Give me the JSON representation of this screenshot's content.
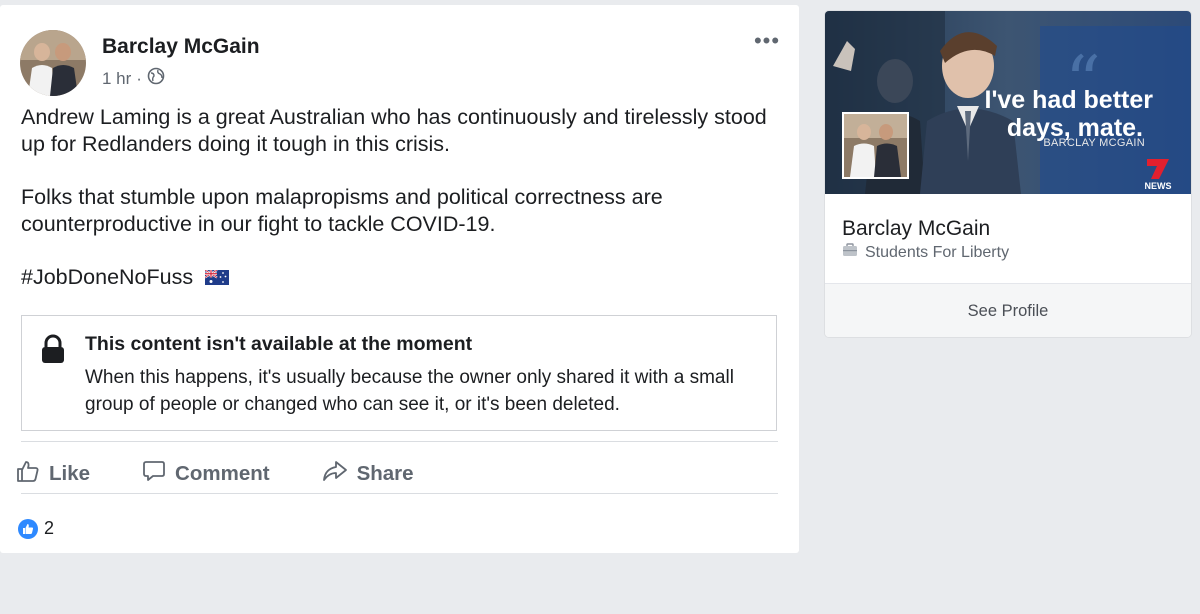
{
  "post": {
    "author": "Barclay McGain",
    "time": "1 hr",
    "separator": "·",
    "more_label": "•••",
    "paragraphs": [
      "Andrew Laming is a great Australian who has continuously and tirelessly stood up for Redlanders doing it tough in this crisis.",
      "Folks that stumble upon malapropisms and political correctness are counterproductive in our fight to tackle COVID-19."
    ],
    "hashtag": "#JobDoneNoFuss",
    "notice": {
      "title": "This content isn't available at the moment",
      "body": "When this happens, it's usually because the owner only shared it with a small group of people or changed who can see it, or it's been deleted."
    },
    "actions": {
      "like": "Like",
      "comment": "Comment",
      "share": "Share"
    },
    "reaction_count": "2"
  },
  "profile_card": {
    "cover_quote_line1": "I've had better",
    "cover_quote_line2": "days, mate.",
    "cover_quote_by": "BARCLAY MCGAIN",
    "news_logo_text": "NEWS",
    "name": "Barclay McGain",
    "workplace": "Students For Liberty",
    "see_profile": "See Profile"
  },
  "colors": {
    "background": "#e9ebee",
    "text_primary": "#1c1e21",
    "text_secondary": "#606770",
    "like_blue": "#2e89ff"
  }
}
